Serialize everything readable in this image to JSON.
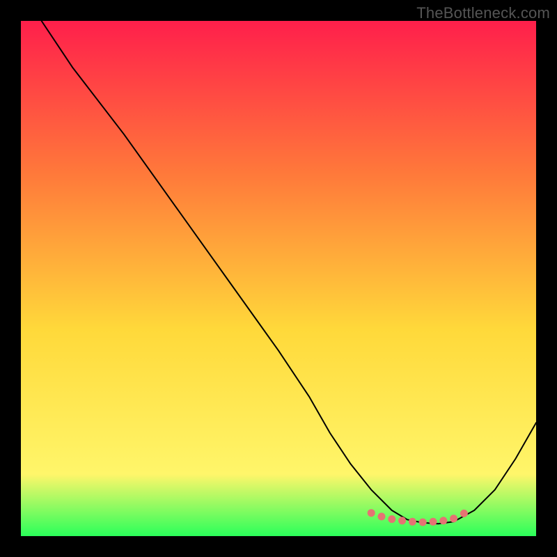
{
  "watermark": "TheBottleneck.com",
  "chart_data": {
    "type": "line",
    "title": "",
    "xlabel": "",
    "ylabel": "",
    "xlim": [
      0,
      100
    ],
    "ylim": [
      0,
      100
    ],
    "grid": false,
    "legend": false,
    "background_gradient": {
      "top": "#ff1f4b",
      "mid_upper": "#ff7a3a",
      "mid": "#ffd93a",
      "mid_lower": "#fff66a",
      "bottom": "#2aff5a"
    },
    "series": [
      {
        "name": "bottleneck-curve",
        "x": [
          4,
          10,
          20,
          30,
          40,
          50,
          56,
          60,
          64,
          68,
          72,
          75,
          78,
          81,
          84,
          88,
          92,
          96,
          100
        ],
        "y": [
          100,
          91,
          78,
          64,
          50,
          36,
          27,
          20,
          14,
          9,
          5,
          3.2,
          2.6,
          2.4,
          2.8,
          5,
          9,
          15,
          22
        ]
      }
    ],
    "markers": {
      "name": "optimal-range-dots",
      "x": [
        68,
        70,
        72,
        74,
        76,
        78,
        80,
        82,
        84,
        86
      ],
      "y": [
        4.5,
        3.8,
        3.3,
        3.0,
        2.8,
        2.7,
        2.8,
        3.0,
        3.4,
        4.4
      ],
      "color": "#e57373"
    }
  }
}
